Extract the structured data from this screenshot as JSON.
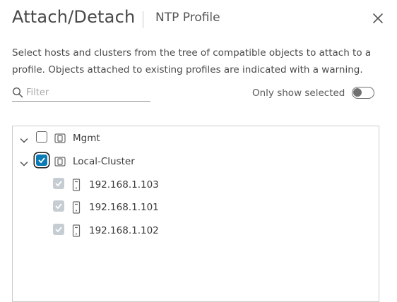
{
  "dialog": {
    "title": "Attach/Detach",
    "subtitle": "NTP Profile",
    "description": "Select hosts and clusters from the tree of compatible objects to attach to a profile. Objects attached to existing profiles are indicated with a warning."
  },
  "filter": {
    "placeholder": "Filter",
    "value": ""
  },
  "toggle": {
    "label": "Only show selected",
    "on": false
  },
  "tree": {
    "clusters": [
      {
        "label": "Mgmt",
        "checked": false,
        "expanded": true,
        "icon": "cluster-icon"
      },
      {
        "label": "Local-Cluster",
        "checked": true,
        "expanded": true,
        "icon": "cluster-icon",
        "hosts": [
          {
            "label": "192.168.1.103",
            "checked": true,
            "disabled": true,
            "icon": "host-icon"
          },
          {
            "label": "192.168.1.101",
            "checked": true,
            "disabled": true,
            "icon": "host-icon"
          },
          {
            "label": "192.168.1.102",
            "checked": true,
            "disabled": true,
            "icon": "host-icon"
          }
        ]
      }
    ]
  },
  "colors": {
    "accent": "#0b7bb5",
    "disabled_check": "#c6cdd2",
    "border": "#cccccc"
  }
}
